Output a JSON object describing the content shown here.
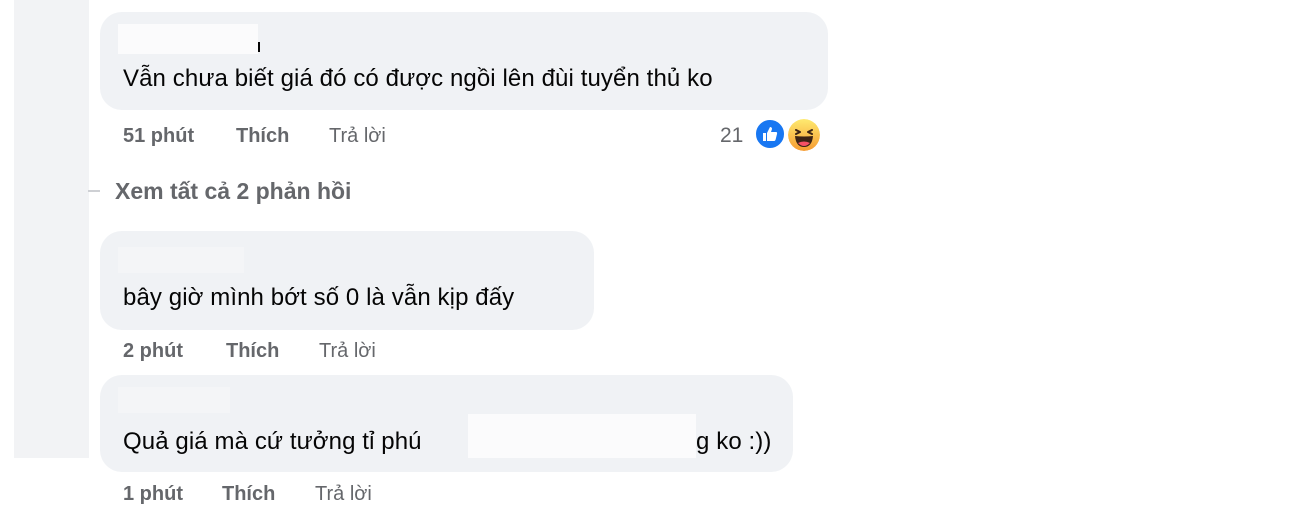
{
  "comments": [
    {
      "text": "Vẫn chưa biết giá đó có được ngồi lên đùi tuyển thủ ko",
      "time": "51 phút",
      "like_label": "Thích",
      "reply_label": "Trả lời",
      "reaction_count": "21",
      "reaction_icons": [
        "like-icon",
        "haha-icon"
      ]
    },
    {
      "text": "bây giờ mình bớt số 0 là vẫn kịp đấy",
      "time": "2 phút",
      "like_label": "Thích",
      "reply_label": "Trả lời"
    },
    {
      "text_before": "Quả giá mà cứ tưởng tỉ phú",
      "text_after": "g ko :))",
      "time": "1 phút",
      "like_label": "Thích",
      "reply_label": "Trả lời"
    }
  ],
  "view_replies_label": "Xem tất cả 2 phản hồi",
  "colors": {
    "bubble": "#f0f2f5",
    "meta_text": "#65676b",
    "like_blue": "#1877f2",
    "haha_yellow": "#f7b928"
  }
}
